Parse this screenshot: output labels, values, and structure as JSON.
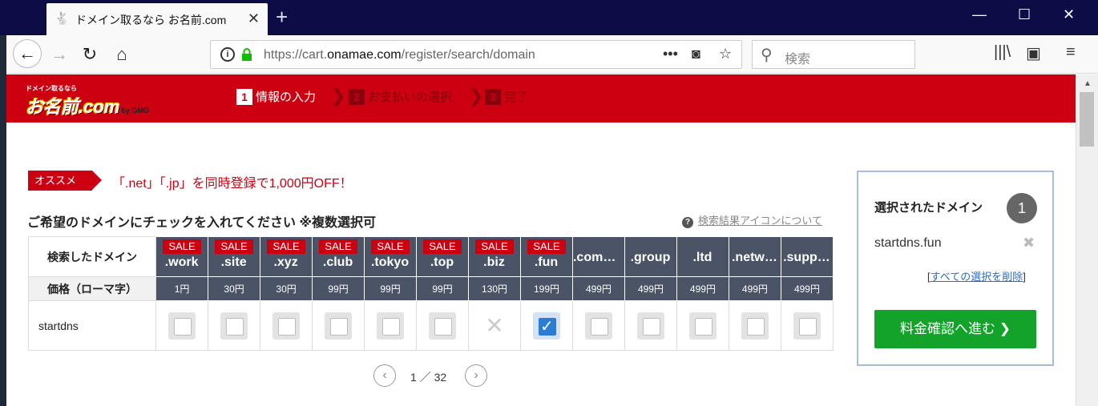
{
  "browser": {
    "tab_title": "ドメイン取るなら お名前.com",
    "url_prefix": "https://cart.",
    "url_domain": "onamae.com",
    "url_path": "/register/search/domain",
    "search_placeholder": "検索"
  },
  "header": {
    "logo_small": "ドメイン取るなら",
    "logo_main": "お名前.com",
    "logo_gmo": "by GMO",
    "steps": [
      {
        "num": "1",
        "label": "情報の入力"
      },
      {
        "num": "2",
        "label": "お支払いの選択"
      },
      {
        "num": "3",
        "label": "完了"
      }
    ]
  },
  "promo": {
    "tag": "オススメ",
    "text": "「.net」「.jp」を同時登録で1,000円OFF！"
  },
  "section": {
    "title": "ご希望のドメインにチェックを入れてください ※複数選択可",
    "help_link": "検索結果アイコンについて"
  },
  "table": {
    "header_label": "検索したドメイン",
    "price_label": "価格（ローマ字）",
    "sale_label": "SALE",
    "tlds": [
      {
        "name": ".work",
        "sale": true,
        "price": "1円"
      },
      {
        "name": ".site",
        "sale": true,
        "price": "30円"
      },
      {
        "name": ".xyz",
        "sale": true,
        "price": "30円"
      },
      {
        "name": ".club",
        "sale": true,
        "price": "99円"
      },
      {
        "name": ".tokyo",
        "sale": true,
        "price": "99円"
      },
      {
        "name": ".top",
        "sale": true,
        "price": "99円"
      },
      {
        "name": ".biz",
        "sale": true,
        "price": "130円"
      },
      {
        "name": ".fun",
        "sale": true,
        "price": "199円"
      },
      {
        "name": ".comp…",
        "sale": false,
        "price": "499円"
      },
      {
        "name": ".group",
        "sale": false,
        "price": "499円"
      },
      {
        "name": ".ltd",
        "sale": false,
        "price": "499円"
      },
      {
        "name": ".netw…",
        "sale": false,
        "price": "499円"
      },
      {
        "name": ".supp…",
        "sale": false,
        "price": "499円"
      }
    ],
    "domain": "startdns",
    "states": [
      "unchecked",
      "unchecked",
      "unchecked",
      "unchecked",
      "unchecked",
      "unchecked",
      "unavailable",
      "checked",
      "unchecked",
      "unchecked",
      "unchecked",
      "unchecked",
      "unchecked"
    ]
  },
  "pager": {
    "text": "1 ／ 32"
  },
  "sidebar": {
    "title": "選択されたドメイン",
    "count": "1",
    "selected_domain": "startdns.fun",
    "clear_prefix": "[",
    "clear_link": "すべての選択を削除",
    "clear_suffix": "]",
    "proceed_button": "料金確認へ進む ❯"
  }
}
